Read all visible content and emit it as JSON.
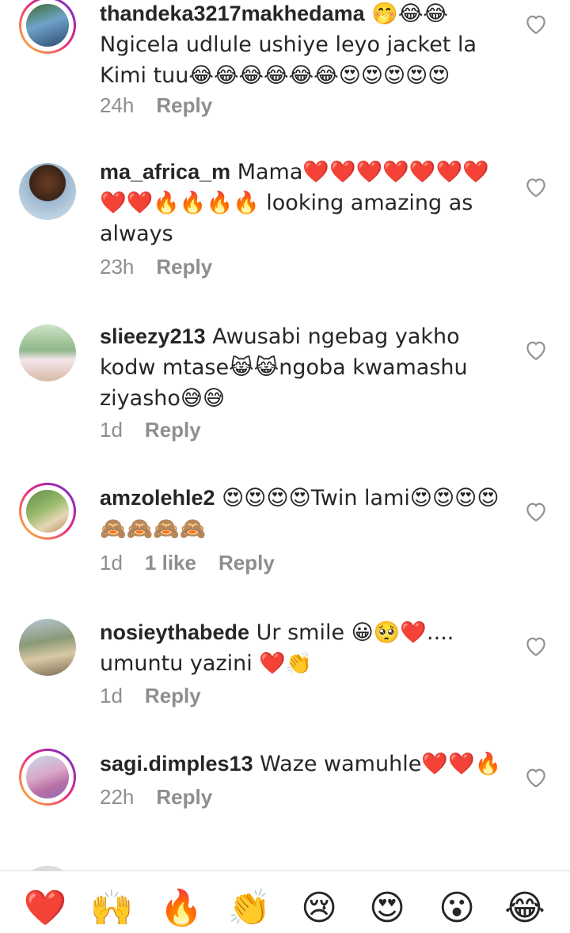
{
  "comments": [
    {
      "user": "thandeka3217makhedama",
      "text": " 🤭😂😂 Ngicela udlule ushiye leyo jacket la Kimi tuu😂😂😂😂😂😂😍😍😍😍😍",
      "time": "24h",
      "likes": "",
      "reply": "Reply"
    },
    {
      "user": "ma_africa_m",
      "text": " Mama❤️❤️❤️❤️❤️❤️❤️❤️❤️🔥🔥🔥🔥 looking amazing as always",
      "time": "23h",
      "likes": "",
      "reply": "Reply"
    },
    {
      "user": "slieezy213",
      "text": " Awusabi ngebag yakho kodw mtase😹😹ngoba kwamashu ziyasho😅😅",
      "time": "1d",
      "likes": "",
      "reply": "Reply"
    },
    {
      "user": "amzolehle2",
      "text": " 😍😍😍😍Twin lami😍😍😍😍🙈🙈🙈🙈",
      "time": "1d",
      "likes": "1 like",
      "reply": "Reply"
    },
    {
      "user": "nosieythabede",
      "text": " Ur smile 😀🥺❤️.... umuntu yazini ❤️👏",
      "time": "1d",
      "likes": "",
      "reply": "Reply"
    },
    {
      "user": "sagi.dimples13",
      "text": " Waze wamuhle❤️❤️🔥",
      "time": "22h",
      "likes": "",
      "reply": "Reply"
    }
  ],
  "partial_comment": "",
  "reactions": [
    "❤️",
    "🙌",
    "🔥",
    "👏",
    "😢",
    "😍",
    "😮",
    "😂"
  ],
  "icons": {
    "like": "heart-outline-icon"
  },
  "colors": {
    "ring_start": "#f9ce34",
    "ring_mid": "#ee2a7b",
    "ring_end": "#6228d7",
    "meta": "#8e8e8e"
  }
}
